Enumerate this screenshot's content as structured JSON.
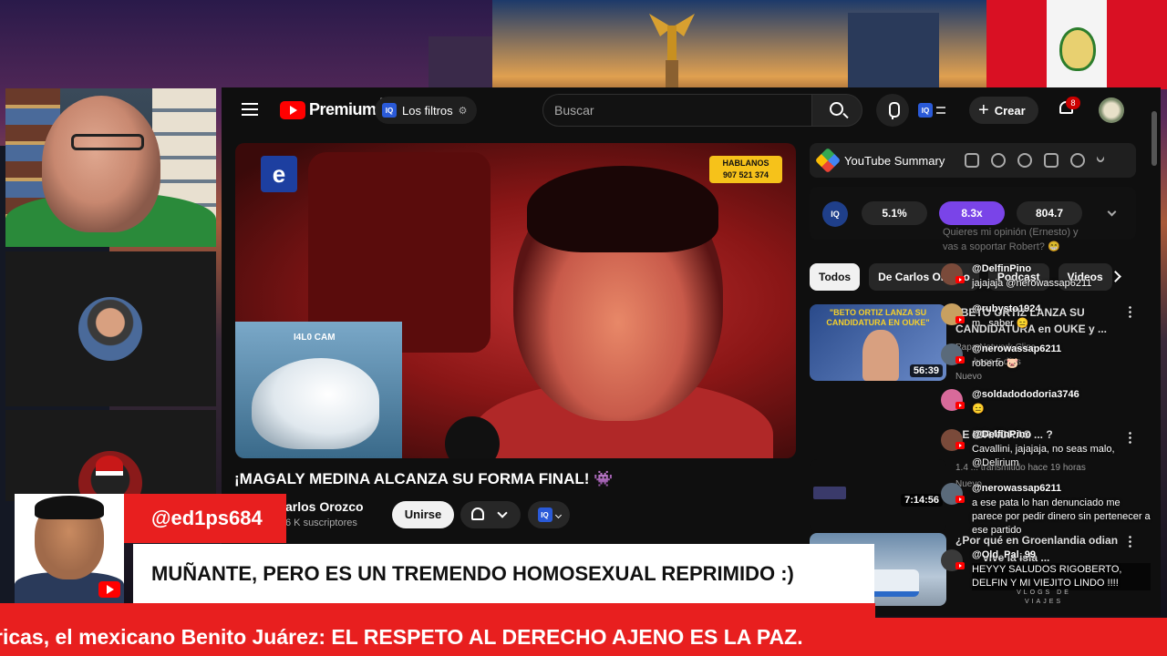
{
  "youtube": {
    "brand": "Premium",
    "country_code": "PE",
    "filters_label": "Los filtros",
    "search_placeholder": "Buscar",
    "create_label": "Crear",
    "notification_count": "8",
    "iq_badge": "IQ"
  },
  "video": {
    "title": "¡MAGALY MEDINA ALCANZA SU FORMA FINAL! 👾",
    "channel": "arlos Orozco",
    "subscribers": "6 K suscriptores",
    "join_label": "Unirse",
    "inset_label": "I4L0 CAM",
    "hablanos_line1": "HABLANOS",
    "hablanos_line2": "907 521 374",
    "logo_letter": "e"
  },
  "summary_panel": {
    "title": "YouTube Summary",
    "stats": [
      "5.1%",
      "8.3x",
      "804.7"
    ],
    "iq": "IQ"
  },
  "chips": [
    "Todos",
    "De Carlos Orozco",
    "Podcast",
    "Videos"
  ],
  "recommendations": [
    {
      "thumb_caption": "\"BETO ORTIZ LANZA SU CANDIDATURA EN OUKE\"",
      "duration": "56:39",
      "title_line1": "\"BETO ORTIZ LANZA SU",
      "title_line2": "CANDIDATURA en OUKE y ...",
      "meta1": "Papa Network Clips",
      "meta2": "hace 5 días",
      "badge": "Nuevo"
    },
    {
      "duration": "7:14:56",
      "title_line1": "¿E IBRAGRAS ... ?",
      "meta1": "1.4 ... transmitido hace 19 horas",
      "badge": "Nuevo"
    },
    {
      "title_line1": "¿Por qué en Groenlandia odian",
      "title_line2": "vive la isla ..."
    }
  ],
  "chat": {
    "ghost_lines": [
      "Quieres mi opinión (Ernesto) y",
      "vas a soportar Robert? 😁"
    ],
    "messages": [
      {
        "user": "@DelfinPino",
        "text": "jajajaja @nerowassap6211",
        "color": "#7a4a3a"
      },
      {
        "user": "@rubysto1924",
        "text": "m.. saber 😑",
        "color": "#c8a060"
      },
      {
        "user": "@nerowassap6211",
        "text": "roberto 🐷",
        "color": "#5a6a7a"
      },
      {
        "user": "@soldadododoria3746",
        "text": "😑",
        "color": "#d86a9a"
      },
      {
        "user": "@DelfinPino",
        "text": "Cavallini, jajajaja, no seas malo, @Delirium",
        "color": "#7a4a3a"
      },
      {
        "user": "@nerowassap6211",
        "text": "a ese pata lo han denunciado me parece por pedir dinero sin pertenecer a ese partido",
        "color": "#5a6a7a"
      },
      {
        "user": "@Old_Pal_99",
        "text": "HEYYY SALUDOS RIGOBERTO, DELFIN Y MI VIEJITO LINDO !!!!",
        "color": "#3a3a3a"
      }
    ]
  },
  "overlay": {
    "handle": "@ed1ps684",
    "message": "MUÑANTE, PERO ES UN TREMENDO HOMOSEXUAL REPRIMIDO :)",
    "ticker": "ricas, el mexicano Benito Juárez: EL RESPETO AL DERECHO AJENO ES LA PAZ.",
    "vlogs_line1": "VLOGS DE",
    "vlogs_line2": "VIAJES"
  },
  "colors": {
    "brand_red": "#ff0000",
    "overlay_red": "#e81f1f",
    "stat_highlight": "#7a44e8"
  }
}
